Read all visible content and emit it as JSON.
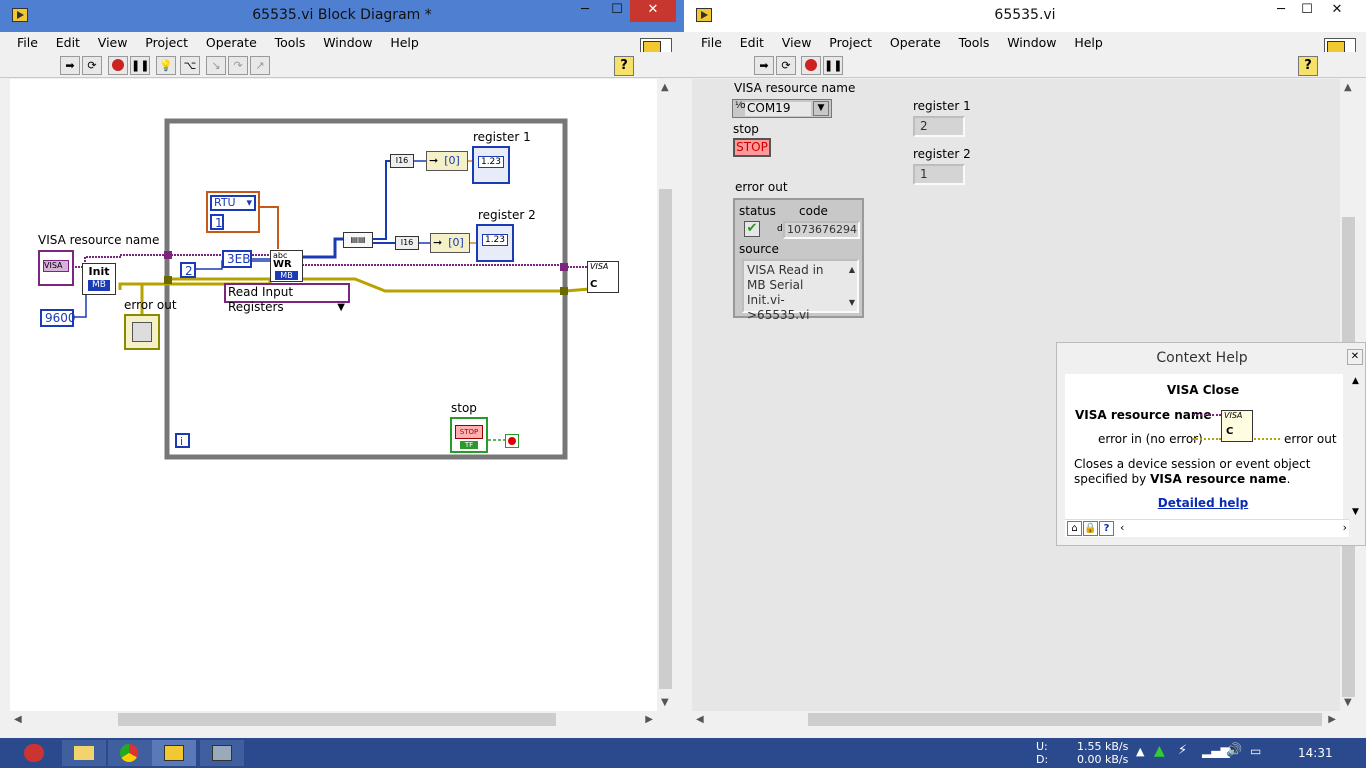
{
  "diagram_window": {
    "title": "65535.vi Block Diagram *",
    "menu": [
      "File",
      "Edit",
      "View",
      "Project",
      "Operate",
      "Tools",
      "Window",
      "Help"
    ],
    "labels": {
      "visa_resource_name": "VISA resource name",
      "error_out": "error out",
      "register1": "register 1",
      "register2": "register 2",
      "stop": "stop"
    },
    "nodes": {
      "rtu": "RTU",
      "rtu_value": "1",
      "num2": "2",
      "hex3eb": "3EB",
      "read_input_registers": "Read Input Registers",
      "baud": "9600",
      "init": "Init",
      "mb": "MB",
      "index0_a": "[0]",
      "index0_b": "[0]",
      "dbl1": "1.23",
      "dbl2": "1.23",
      "iter": "i",
      "stop_text": "STOP",
      "tf": "TF",
      "visa_small": "VISA",
      "visa_close": "VISA",
      "wr": "WR"
    }
  },
  "panel_window": {
    "title": "65535.vi",
    "menu": [
      "File",
      "Edit",
      "View",
      "Project",
      "Operate",
      "Tools",
      "Window",
      "Help"
    ],
    "visa_label": "VISA resource name",
    "visa_value": "COM19",
    "stop_label": "stop",
    "stop_button": "STOP",
    "register1_label": "register 1",
    "register1_value": "2",
    "register2_label": "register 2",
    "register2_value": "1",
    "error_out_label": "error out",
    "status_label": "status",
    "code_label": "code",
    "code_value": "1073676294",
    "code_prefix": "d",
    "source_label": "source",
    "source_value": "VISA Read in MB Serial Init.vi->65535.vi"
  },
  "context_help": {
    "title": "Context Help",
    "function_name": "VISA Close",
    "input1": "VISA resource name",
    "input2": "error in (no error)",
    "output": "error out",
    "icon_text": "VISA",
    "desc_plain1": "Closes a device session or event object specified by ",
    "desc_bold": "VISA resource name",
    "desc_plain2": ".",
    "link": "Detailed help"
  },
  "taskbar": {
    "net_up_label": "U:",
    "net_up": "1.55 kB/s",
    "net_down_label": "D:",
    "net_down": "0.00 kB/s",
    "time": "14:31"
  },
  "colors": {
    "accent": "#4f7fd0",
    "wire_blue": "#1a3bb5",
    "wire_error": "#b7a300",
    "wire_visa": "#7b2580",
    "taskbar": "#2b4a8d"
  }
}
